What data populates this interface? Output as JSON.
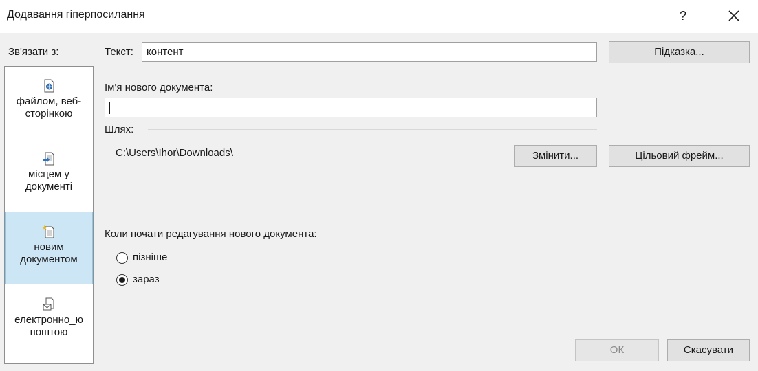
{
  "window": {
    "title": "Додавання гіперпосилання",
    "help_label": "?",
    "close_icon": "close-icon"
  },
  "link_to": {
    "label": "Зв'язати з:",
    "items": [
      {
        "label": "файлом, веб-сторінкою",
        "icon": "web-page-icon",
        "selected": false
      },
      {
        "label": "місцем у документі",
        "icon": "place-in-document-icon",
        "selected": false
      },
      {
        "label": "новим документом",
        "icon": "new-document-icon",
        "selected": true
      },
      {
        "label": "електронно_ю поштою",
        "icon": "email-icon",
        "selected": false
      }
    ]
  },
  "text_to_display": {
    "label": "Текст:",
    "value": "контент"
  },
  "screentip_button": "Підказка...",
  "new_doc_name": {
    "label": "Ім'я нового документа:",
    "value": ""
  },
  "path": {
    "label": "Шлях:",
    "value": "C:\\Users\\Ihor\\Downloads\\",
    "change_button": "Змінити..."
  },
  "target_frame_button": "Цільовий фрейм...",
  "edit_when": {
    "label": "Коли почати редагування нового документа:",
    "options": [
      {
        "label": "пізніше",
        "selected": false
      },
      {
        "label": "зараз",
        "selected": true
      }
    ]
  },
  "ok_button": "ОК",
  "cancel_button": "Скасувати"
}
